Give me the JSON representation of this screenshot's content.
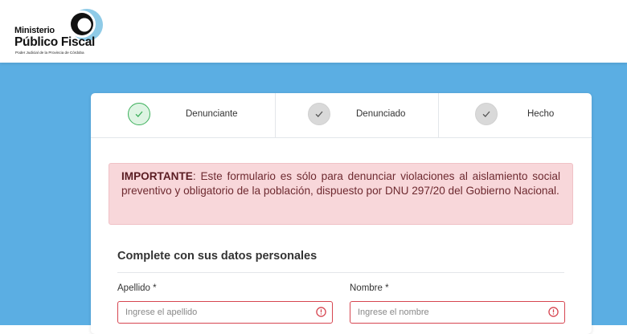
{
  "header": {
    "logo": {
      "line1": "Ministerio",
      "line2": "Público Fiscal",
      "line3": "Poder Judicial de la Provincia de Córdoba"
    }
  },
  "steps": [
    {
      "label": "Denunciante",
      "state": "active",
      "icon": "check-icon"
    },
    {
      "label": "Denunciado",
      "state": "inactive",
      "icon": "check-icon"
    },
    {
      "label": "Hecho",
      "state": "inactive",
      "icon": "check-icon"
    }
  ],
  "alert": {
    "strong": "IMPORTANTE",
    "text": ": Este formulario es sólo para denunciar violaciones al aislamiento social preventivo y obligatorio de la población, dispuesto por DNU 297/20 del Gobierno Nacional."
  },
  "form": {
    "section_title": "Complete con sus datos personales",
    "apellido": {
      "label": "Apellido *",
      "placeholder": "Ingrese el apellido",
      "value": ""
    },
    "nombre": {
      "label": "Nombre *",
      "placeholder": "Ingrese el nombre",
      "value": ""
    }
  },
  "colors": {
    "background": "#5baee3",
    "alert_bg": "#f8d7da",
    "error": "#d64550",
    "step_active": "#3cb05b"
  }
}
